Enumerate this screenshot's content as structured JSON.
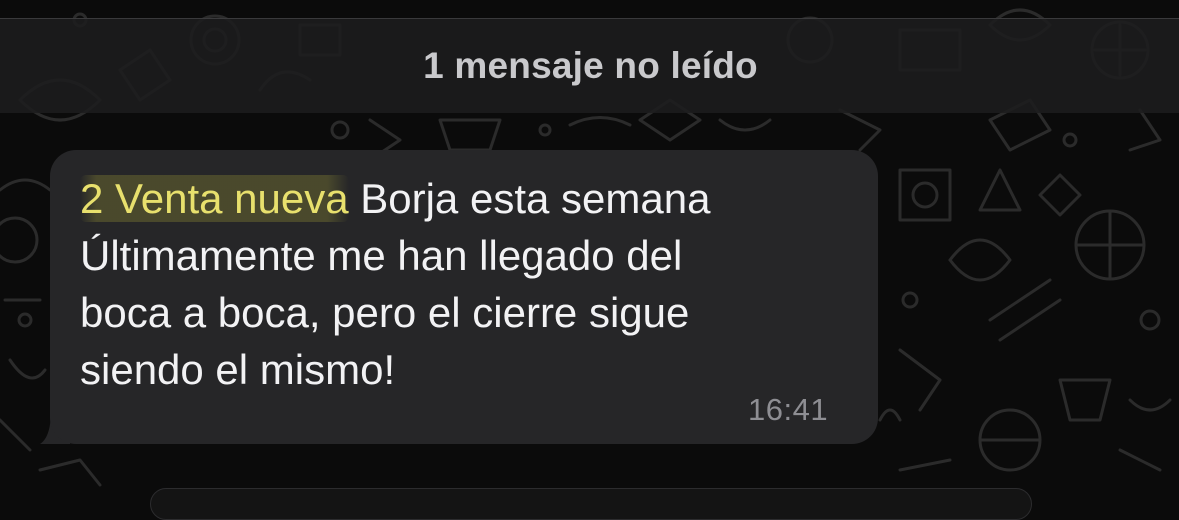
{
  "unread_banner": {
    "label": "1 mensaje no leído"
  },
  "message": {
    "highlighted_text": "2 Venta nueva",
    "line1_rest": " Borja esta semana",
    "line2": "Últimamente me han llegado del",
    "line3": "boca a boca, pero el cierre sigue",
    "line4": "siendo el mismo!",
    "time": "16:41"
  },
  "colors": {
    "background": "#0b0b0b",
    "bubble": "#262628",
    "message_text": "#f2f2f4",
    "highlight_text": "#e8e06d",
    "timestamp": "#8e8e93",
    "unread_banner_text": "#c9c9cc"
  },
  "icons": [
    "chat-wallpaper-doodle-pattern"
  ]
}
